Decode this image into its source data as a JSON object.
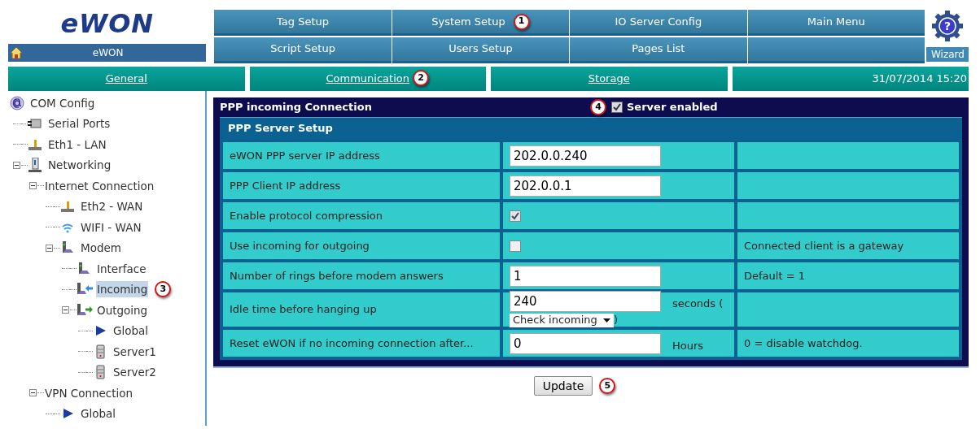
{
  "logo": {
    "text": "eWON"
  },
  "home": {
    "label": "eWON"
  },
  "nav": [
    {
      "label": "Tag Setup"
    },
    {
      "label": "System Setup",
      "badge": "1"
    },
    {
      "label": "IO Server Config"
    },
    {
      "label": "Main Menu"
    },
    {
      "label": "Script Setup"
    },
    {
      "label": "Users Setup"
    },
    {
      "label": "Pages List"
    }
  ],
  "wizard": {
    "glyph": "?",
    "label": "Wizard"
  },
  "tabs": [
    {
      "label": "General"
    },
    {
      "label": "Communication",
      "badge": "2"
    },
    {
      "label": "Storage"
    }
  ],
  "datetime": "31/07/2014 15:20",
  "tree": {
    "label": "COM Config",
    "kind": "at",
    "children": [
      {
        "label": "Serial Ports",
        "kind": "serial",
        "selected": false
      },
      {
        "label": "Eth1 - LAN",
        "kind": "net",
        "selected": false
      },
      {
        "label": "Networking",
        "kind": "tower",
        "selected": false,
        "expanded": true,
        "children": [
          {
            "label": "Internet Connection",
            "selected": false,
            "expanded": true,
            "children": [
              {
                "label": "Eth2 - WAN",
                "kind": "net",
                "selected": false
              },
              {
                "label": "WIFI - WAN",
                "kind": "wifi",
                "selected": false
              },
              {
                "label": "Modem",
                "kind": "modem",
                "selected": false,
                "expanded": true,
                "children": [
                  {
                    "label": "Interface",
                    "kind": "modem",
                    "selected": false
                  },
                  {
                    "label": "Incoming",
                    "kind": "modem-in",
                    "selected": true,
                    "badge": "3"
                  },
                  {
                    "label": "Outgoing",
                    "kind": "modem-out",
                    "selected": false,
                    "expanded": true,
                    "children": [
                      {
                        "label": "Global",
                        "kind": "play",
                        "selected": false
                      },
                      {
                        "label": "Server1",
                        "kind": "server",
                        "selected": false
                      },
                      {
                        "label": "Server2",
                        "kind": "server",
                        "selected": false
                      }
                    ]
                  }
                ]
              }
            ]
          },
          {
            "label": "VPN Connection",
            "selected": false,
            "expanded": true,
            "children": [
              {
                "label": "Global",
                "kind": "play",
                "selected": false
              }
            ]
          }
        ]
      }
    ]
  },
  "panel": {
    "title": "PPP incoming Connection",
    "enabled_label": "Server enabled",
    "enabled": true,
    "badge": "4",
    "section": "PPP Server Setup",
    "rows": [
      {
        "kind": "input",
        "label": "eWON PPP server IP address",
        "value": "202.0.0.240"
      },
      {
        "kind": "input",
        "label": "PPP Client IP address",
        "value": "202.0.0.1"
      },
      {
        "kind": "checkbox",
        "label": "Enable protocol compression",
        "checked": true
      },
      {
        "kind": "checkbox",
        "label": "Use incoming for outgoing",
        "checked": false,
        "note": "Connected client is a gateway"
      },
      {
        "kind": "input",
        "label": "Number of rings before modem answers",
        "value": "1",
        "note": "Default = 1"
      },
      {
        "kind": "input-select",
        "label": "Idle time before hanging up",
        "value": "240",
        "suffix": "seconds (",
        "select": "Check incoming",
        "close": ")"
      },
      {
        "kind": "input",
        "label": "Reset eWON if no incoming connection after...",
        "value": "0",
        "suffix": "Hours",
        "note": "0 = disable watchdog."
      }
    ]
  },
  "update": {
    "label": "Update",
    "badge": "5"
  }
}
